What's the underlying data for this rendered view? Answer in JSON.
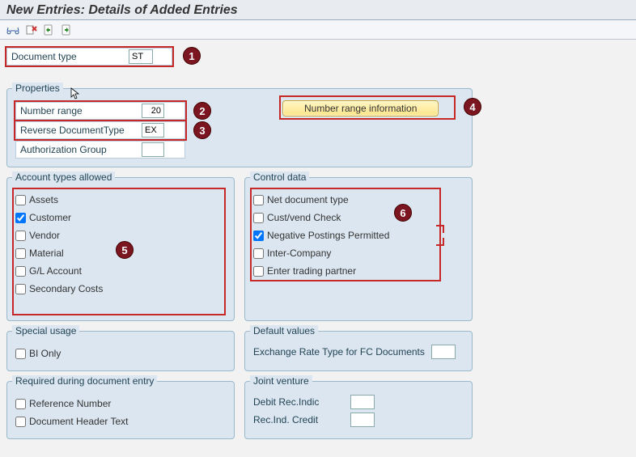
{
  "header": {
    "title": "New Entries: Details of Added Entries"
  },
  "doc_type": {
    "label": "Document type",
    "value": "ST"
  },
  "properties": {
    "title": "Properties",
    "number_range": {
      "label": "Number range",
      "value": "20"
    },
    "reverse_doc_type": {
      "label": "Reverse DocumentType",
      "value": "EX"
    },
    "auth_group": {
      "label": "Authorization Group",
      "value": ""
    },
    "nri_button": "Number range information"
  },
  "account_types": {
    "title": "Account types allowed",
    "items": [
      {
        "label": "Assets",
        "checked": false
      },
      {
        "label": "Customer",
        "checked": true
      },
      {
        "label": "Vendor",
        "checked": false
      },
      {
        "label": "Material",
        "checked": false
      },
      {
        "label": "G/L Account",
        "checked": false
      },
      {
        "label": "Secondary Costs",
        "checked": false
      }
    ]
  },
  "control_data": {
    "title": "Control data",
    "items": [
      {
        "label": "Net document type",
        "checked": false
      },
      {
        "label": "Cust/vend Check",
        "checked": false
      },
      {
        "label": "Negative Postings Permitted",
        "checked": true
      },
      {
        "label": "Inter-Company",
        "checked": false
      },
      {
        "label": "Enter trading partner",
        "checked": false
      }
    ]
  },
  "special_usage": {
    "title": "Special usage",
    "bi_only": {
      "label": "BI Only",
      "checked": false
    }
  },
  "default_values": {
    "title": "Default values",
    "ex_rate": {
      "label": "Exchange Rate Type for FC Documents",
      "value": ""
    }
  },
  "required_entry": {
    "title": "Required during document entry",
    "ref_no": {
      "label": "Reference Number",
      "checked": false
    },
    "doc_header": {
      "label": "Document Header Text",
      "checked": false
    }
  },
  "joint_venture": {
    "title": "Joint venture",
    "debit": {
      "label": "Debit Rec.Indic",
      "value": ""
    },
    "credit": {
      "label": "Rec.Ind. Credit",
      "value": ""
    }
  },
  "markers": {
    "m1": "1",
    "m2": "2",
    "m3": "3",
    "m4": "4",
    "m5": "5",
    "m6": "6"
  }
}
